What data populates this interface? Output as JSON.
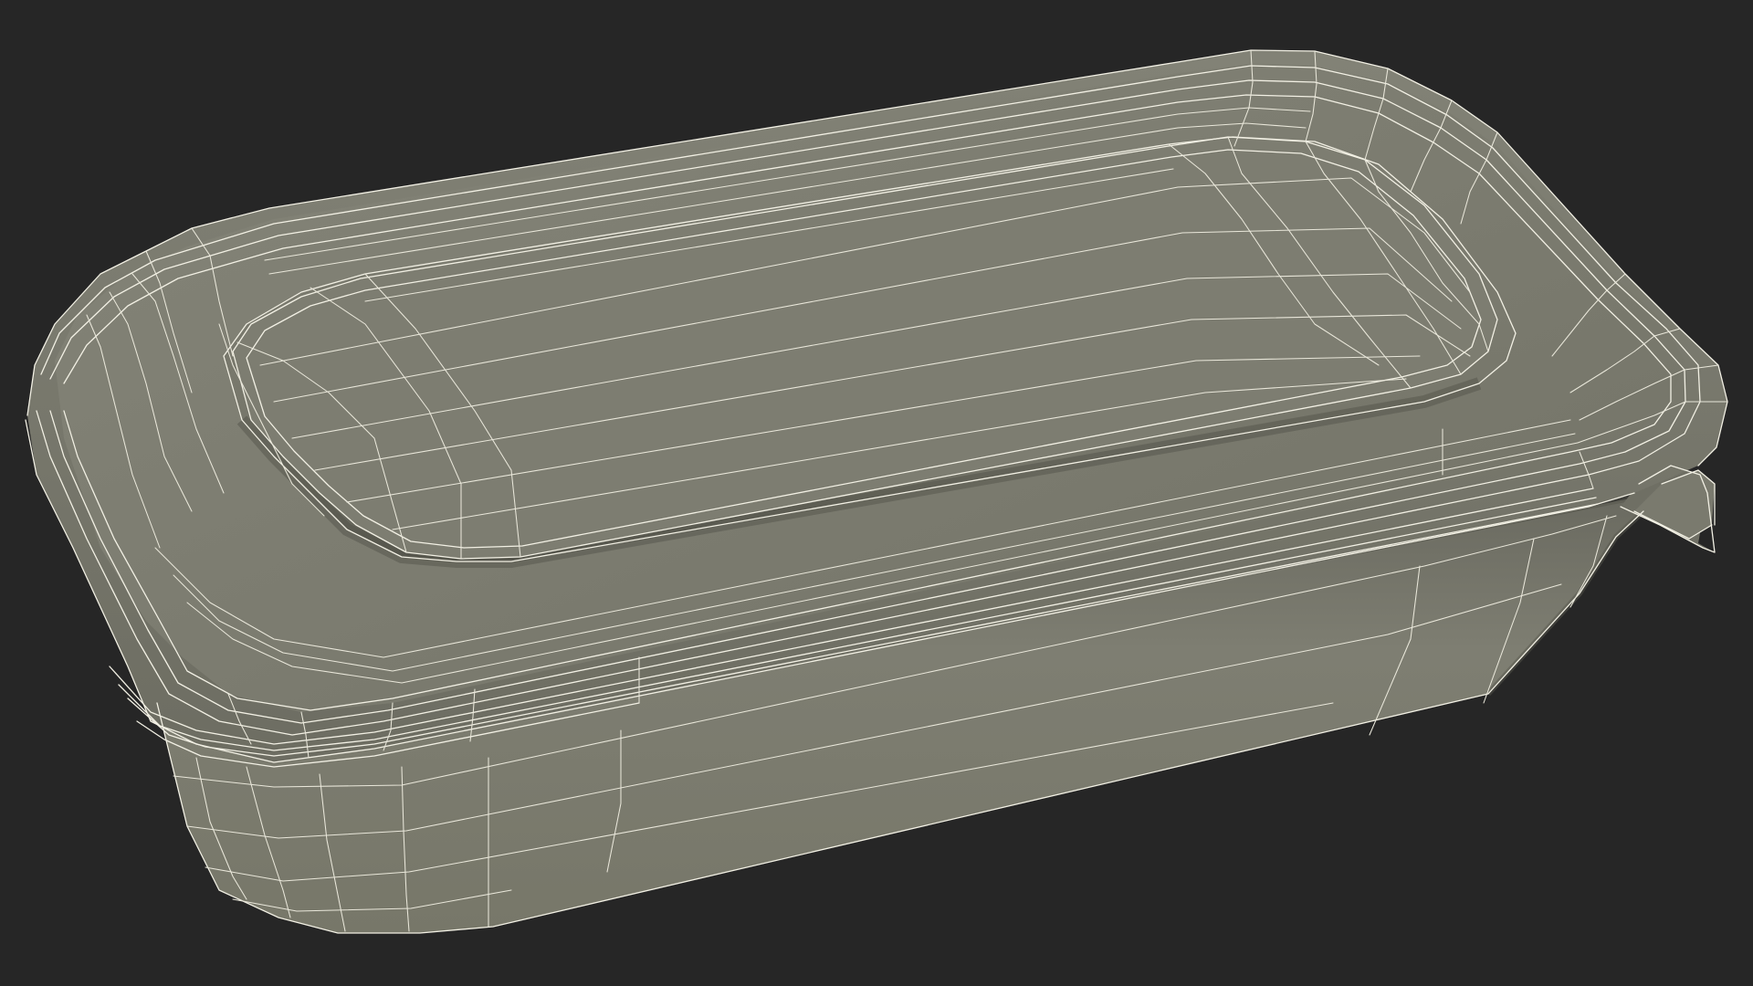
{
  "scene": {
    "background_color": "#262626",
    "mesh_color": "#7b7b6f",
    "mesh_shadow_color": "#5f5f55",
    "wire_color": "#f2f0e4",
    "subject_icon": "food-container-wireframe-icon"
  }
}
